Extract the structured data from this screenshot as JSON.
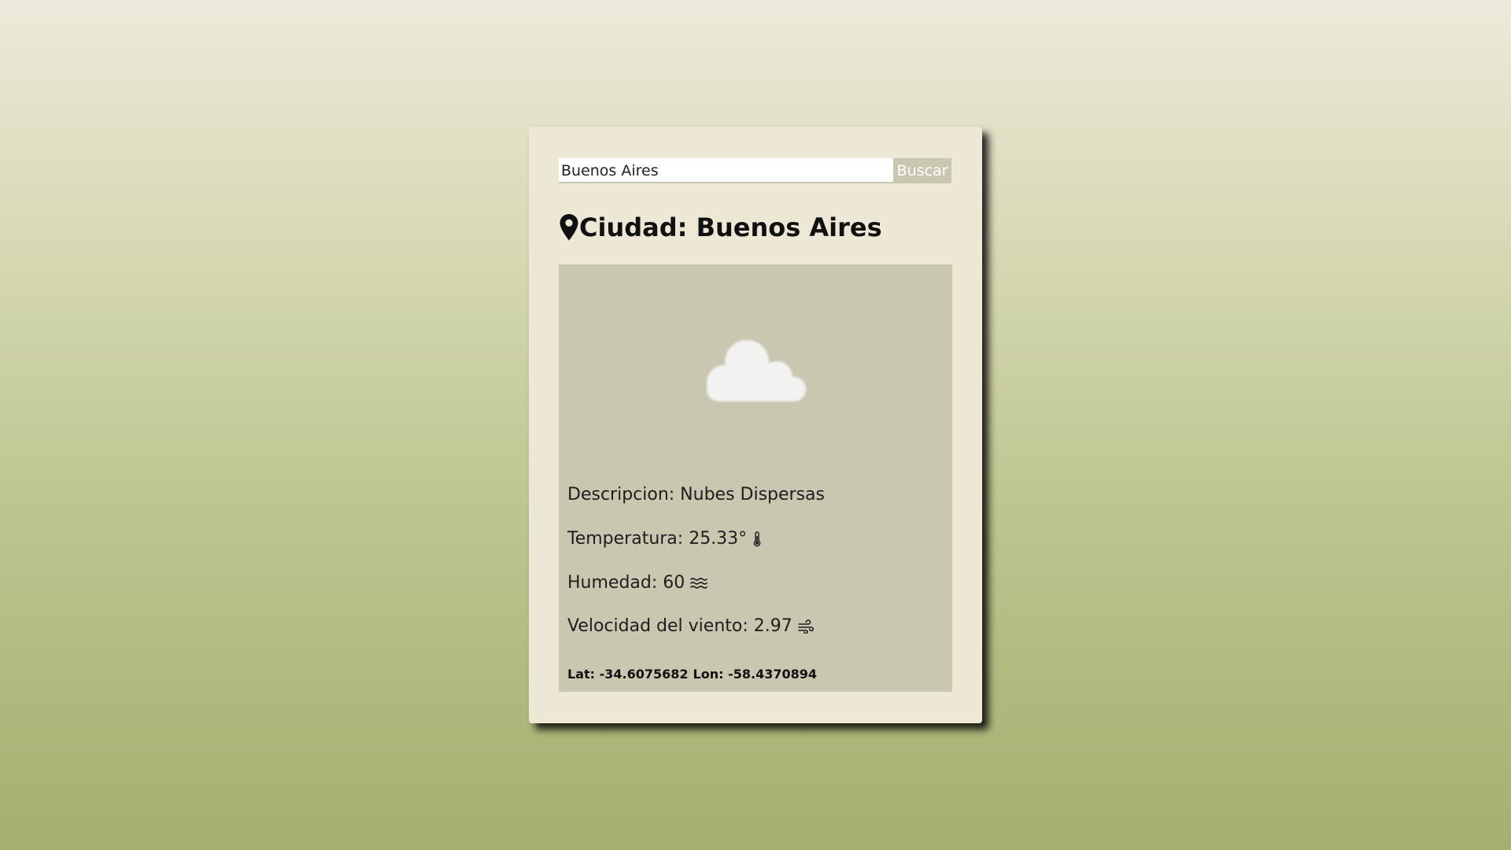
{
  "search": {
    "value": "Buenos Aires",
    "button_label": "Buscar"
  },
  "city": {
    "label": "Ciudad: Buenos Aires"
  },
  "weather": {
    "icon": "cloud-icon",
    "description": "Descripcion: Nubes Dispersas",
    "temperature": "Temperatura: 25.33°",
    "humidity": "Humedad: 60",
    "wind_speed": "Velocidad del viento: 2.97",
    "lat": "Lat: -34.6075682",
    "lon": "Lon: -58.4370894"
  },
  "colors": {
    "card_bg": "#ece8d5",
    "panel_bg": "#c9c7b0",
    "button_bg": "#cac7b0",
    "cloud": "#f2f2f0"
  }
}
